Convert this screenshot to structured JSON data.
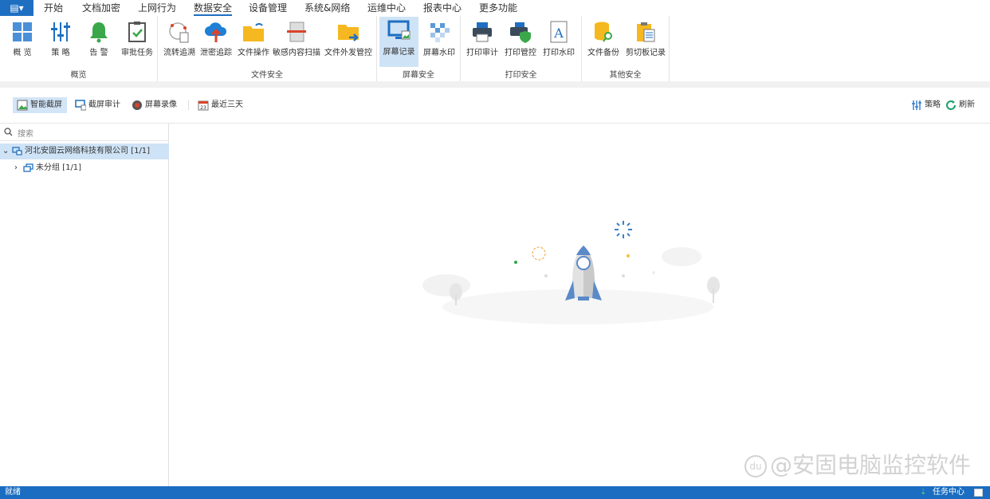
{
  "menu": {
    "tabs": [
      "开始",
      "文档加密",
      "上网行为",
      "数据安全",
      "设备管理",
      "系统&网络",
      "运维中心",
      "报表中心",
      "更多功能"
    ],
    "active": "数据安全"
  },
  "ribbon": {
    "groups": [
      {
        "label": "概览",
        "buttons": [
          "概 览",
          "策 略",
          "告 警",
          "审批任务"
        ]
      },
      {
        "label": "文件安全",
        "buttons": [
          "流转追溯",
          "泄密追踪",
          "文件操作",
          "敏感内容扫描",
          "文件外发管控"
        ]
      },
      {
        "label": "屏幕安全",
        "buttons": [
          "屏幕记录",
          "屏幕水印"
        ]
      },
      {
        "label": "打印安全",
        "buttons": [
          "打印审计",
          "打印管控",
          "打印水印"
        ]
      },
      {
        "label": "其他安全",
        "buttons": [
          "文件备份",
          "剪切板记录"
        ]
      }
    ],
    "selected": "屏幕记录"
  },
  "toolbar": {
    "smart_capture": "智能截屏",
    "capture_audit": "截屏审计",
    "screen_record": "屏幕录像",
    "date_range": "最近三天",
    "calendar_day": "23",
    "policy": "策略",
    "refresh": "刷新"
  },
  "tree": {
    "search_placeholder": "搜索",
    "root": "河北安固云网络科技有限公司  [1/1]",
    "child": "未分组  [1/1]"
  },
  "status": {
    "left": "就绪",
    "task_center": "任务中心"
  },
  "watermark": "@安固电脑监控软件",
  "colors": {
    "accent": "#1e6fc2",
    "status_bar": "#1a6dc0",
    "selected": "#cfe3f6"
  }
}
